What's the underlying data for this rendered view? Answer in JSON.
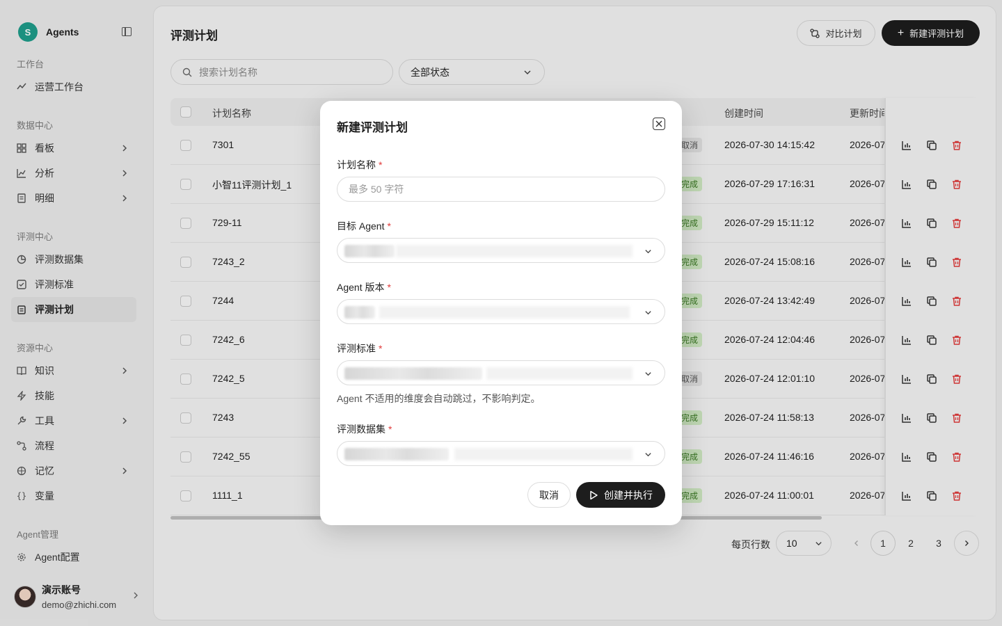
{
  "sidebar": {
    "brand": {
      "logo_letter": "S",
      "name": "Agents"
    },
    "sections": {
      "workbench": "工作台",
      "data": "数据中心",
      "eval": "评测中心",
      "resource": "资源中心",
      "agent": "Agent管理"
    },
    "items": {
      "ops": "运营工作台",
      "board": "看板",
      "analysis": "分析",
      "detail": "明细",
      "dataset": "评测数据集",
      "standard": "评测标准",
      "plan": "评测计划",
      "knowledge": "知识",
      "skill": "技能",
      "tool": "工具",
      "flow": "流程",
      "memory": "记忆",
      "variable": "变量",
      "agent_config": "Agent配置"
    },
    "active_item": "plan",
    "user": {
      "name": "演示账号",
      "email": "demo@zhichi.com"
    }
  },
  "main": {
    "title": "评测计划",
    "compare_btn": "对比计划",
    "new_btn": "新建评测计划",
    "search_placeholder": "搜索计划名称",
    "status_filter": "全部状态",
    "table": {
      "headers": {
        "name": "计划名称",
        "created": "创建时间",
        "updated": "更新时间"
      },
      "rows": [
        {
          "name": "7301",
          "status": "取消",
          "status_type": "cancel",
          "created": "2026-07-30 14:15:42",
          "updated": "2026-07"
        },
        {
          "name": "小智11评测计划_1",
          "status": "完成",
          "status_type": "done",
          "created": "2026-07-29 17:16:31",
          "updated": "2026-07"
        },
        {
          "name": "729-11",
          "status": "完成",
          "status_type": "done",
          "created": "2026-07-29 15:11:12",
          "updated": "2026-07"
        },
        {
          "name": "7243_2",
          "status": "完成",
          "status_type": "done",
          "created": "2026-07-24 15:08:16",
          "updated": "2026-07"
        },
        {
          "name": "7244",
          "status": "完成",
          "status_type": "done",
          "created": "2026-07-24 13:42:49",
          "updated": "2026-07"
        },
        {
          "name": "7242_6",
          "status": "完成",
          "status_type": "done",
          "created": "2026-07-24 12:04:46",
          "updated": "2026-07"
        },
        {
          "name": "7242_5",
          "status": "取消",
          "status_type": "cancel",
          "created": "2026-07-24 12:01:10",
          "updated": "2026-07"
        },
        {
          "name": "7243",
          "status": "完成",
          "status_type": "done",
          "created": "2026-07-24 11:58:13",
          "updated": "2026-07"
        },
        {
          "name": "7242_55",
          "status": "完成",
          "status_type": "done",
          "created": "2026-07-24 11:46:16",
          "updated": "2026-07"
        },
        {
          "name": "1111_1",
          "status": "完成",
          "status_type": "done",
          "created": "2026-07-24 11:00:01",
          "updated": "2026-07"
        }
      ]
    },
    "pagination": {
      "rows_label": "每页行数",
      "page_size": "10",
      "pages": [
        "1",
        "2",
        "3"
      ],
      "current": "1"
    }
  },
  "modal": {
    "title": "新建评测计划",
    "fields": {
      "name": {
        "label": "计划名称",
        "placeholder": "最多 50 字符"
      },
      "agent": {
        "label": "目标 Agent"
      },
      "version": {
        "label": "Agent 版本"
      },
      "standard": {
        "label": "评测标准"
      },
      "dataset": {
        "label": "评测数据集"
      }
    },
    "required_mark": "*",
    "hint": "Agent 不适用的维度会自动跳过，不影响判定。",
    "cancel": "取消",
    "submit": "创建并执行"
  },
  "colors": {
    "accent": "#1d1d1d",
    "brand": "#1f9d8a",
    "danger": "#e03b3b",
    "done_badge": "#cfe9c2"
  }
}
